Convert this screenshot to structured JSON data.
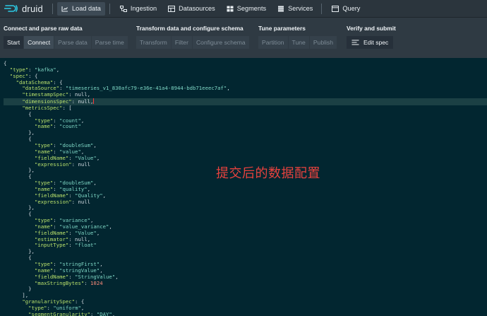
{
  "app": {
    "name": "druid"
  },
  "nav": {
    "items": [
      {
        "label": "Load data",
        "icon": "load-data-icon",
        "active": true
      },
      {
        "label": "Ingestion",
        "icon": "ingestion-icon"
      },
      {
        "label": "Datasources",
        "icon": "datasources-icon"
      },
      {
        "label": "Segments",
        "icon": "segments-icon"
      },
      {
        "label": "Services",
        "icon": "services-icon"
      },
      {
        "label": "Query",
        "icon": "query-icon"
      }
    ]
  },
  "steps": {
    "groups": [
      {
        "title": "Connect and parse raw data",
        "buttons": [
          "Start",
          "Connect",
          "Parse data",
          "Parse time"
        ]
      },
      {
        "title": "Transform data and configure schema",
        "buttons": [
          "Transform",
          "Filter",
          "Configure schema"
        ]
      },
      {
        "title": "Tune parameters",
        "buttons": [
          "Partition",
          "Tune",
          "Publish"
        ]
      },
      {
        "title": "Verify and submit",
        "buttons": [
          "Edit spec"
        ]
      }
    ]
  },
  "editor": {
    "lines": [
      "{",
      "  \"type\": \"kafka\",",
      "  \"spec\": {",
      "    \"dataSchema\": {",
      "      \"dataSource\": \"timeseries_v1_830afc79-e36e-41a4-8944-bdb71eeec7af\",",
      "      \"timestampSpec\": null,",
      "      \"dimensionsSpec\": null,",
      "      \"metricsSpec\": [",
      "        {",
      "          \"type\": \"count\",",
      "          \"name\": \"count\"",
      "        },",
      "        {",
      "          \"type\": \"doubleSum\",",
      "          \"name\": \"value\",",
      "          \"fieldName\": \"Value\",",
      "          \"expression\": null",
      "        },",
      "        {",
      "          \"type\": \"doubleSum\",",
      "          \"name\": \"quality\",",
      "          \"fieldName\": \"Quality\",",
      "          \"expression\": null",
      "        },",
      "        {",
      "          \"type\": \"variance\",",
      "          \"name\": \"value_variance\",",
      "          \"fieldName\": \"Value\",",
      "          \"estimator\": null,",
      "          \"inputType\": \"float\"",
      "        },",
      "        {",
      "          \"type\": \"stringFirst\",",
      "          \"name\": \"stringValue\",",
      "          \"fieldName\": \"StringValue\",",
      "          \"maxStringBytes\": 1024",
      "        }",
      "      ],",
      "      \"granularitySpec\": {",
      "        \"type\": \"uniform\",",
      "        \"segmentGranularity\": \"DAY\",",
      "        \"queryGranularity\": {",
      "          \"type\": \"none\""
    ],
    "highlighted_line": 7,
    "annotation": "提交后的数据配置"
  },
  "colors": {
    "navbar_bg": "#2b353d",
    "page_bg": "#2f3a43",
    "editor_bg": "#022630",
    "key": "#b8e06b",
    "string": "#7fd8c6",
    "number": "#ff8c7a",
    "annotation": "#e8423e",
    "logo": "#2ccbe6"
  }
}
